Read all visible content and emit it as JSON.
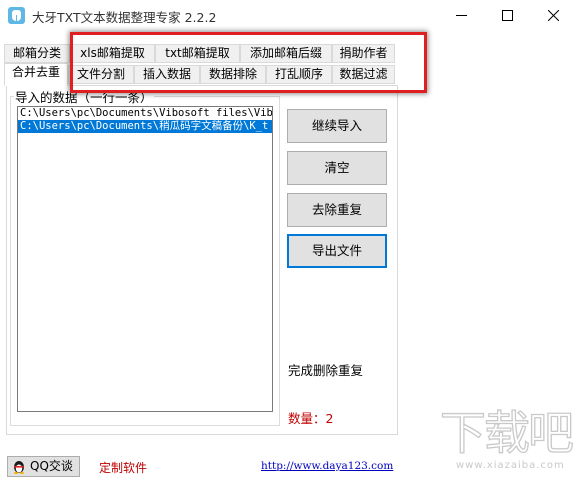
{
  "window": {
    "title": "大牙TXT文本数据整理专家 2.2.2"
  },
  "tabs": {
    "row1": [
      "邮箱分类",
      "xls邮箱提取",
      "txt邮箱提取",
      "添加邮箱后缀",
      "捐助作者"
    ],
    "row2": [
      "合并去重",
      "文件分割",
      "插入数据",
      "数据排除",
      "打乱顺序",
      "数据过滤"
    ],
    "active": "合并去重"
  },
  "import_group": {
    "title": "导入的数据（一行一条）",
    "items": [
      "C:\\Users\\pc\\Documents\\Vibosoft files\\Vibos",
      "C:\\Users\\pc\\Documents\\稍瓜码字文稿备份\\K_t"
    ],
    "selected_index": 1
  },
  "actions": {
    "continue_import": "继续导入",
    "clear": "清空",
    "dedupe": "去除重复",
    "export": "导出文件"
  },
  "status": {
    "message": "完成删除重复",
    "count_label": "数量：2"
  },
  "footer": {
    "qq_button": "QQ交谈",
    "custom_link": "定制软件",
    "site_link": "http://www.daya123.com"
  },
  "watermark": {
    "glyphs": [
      "下",
      "载",
      "吧"
    ],
    "url": "www.xiazaiba.com"
  },
  "colors": {
    "selection": "#0078d7",
    "highlight_box": "#e02020",
    "alert_text": "#c00000",
    "link": "#0000c0"
  }
}
